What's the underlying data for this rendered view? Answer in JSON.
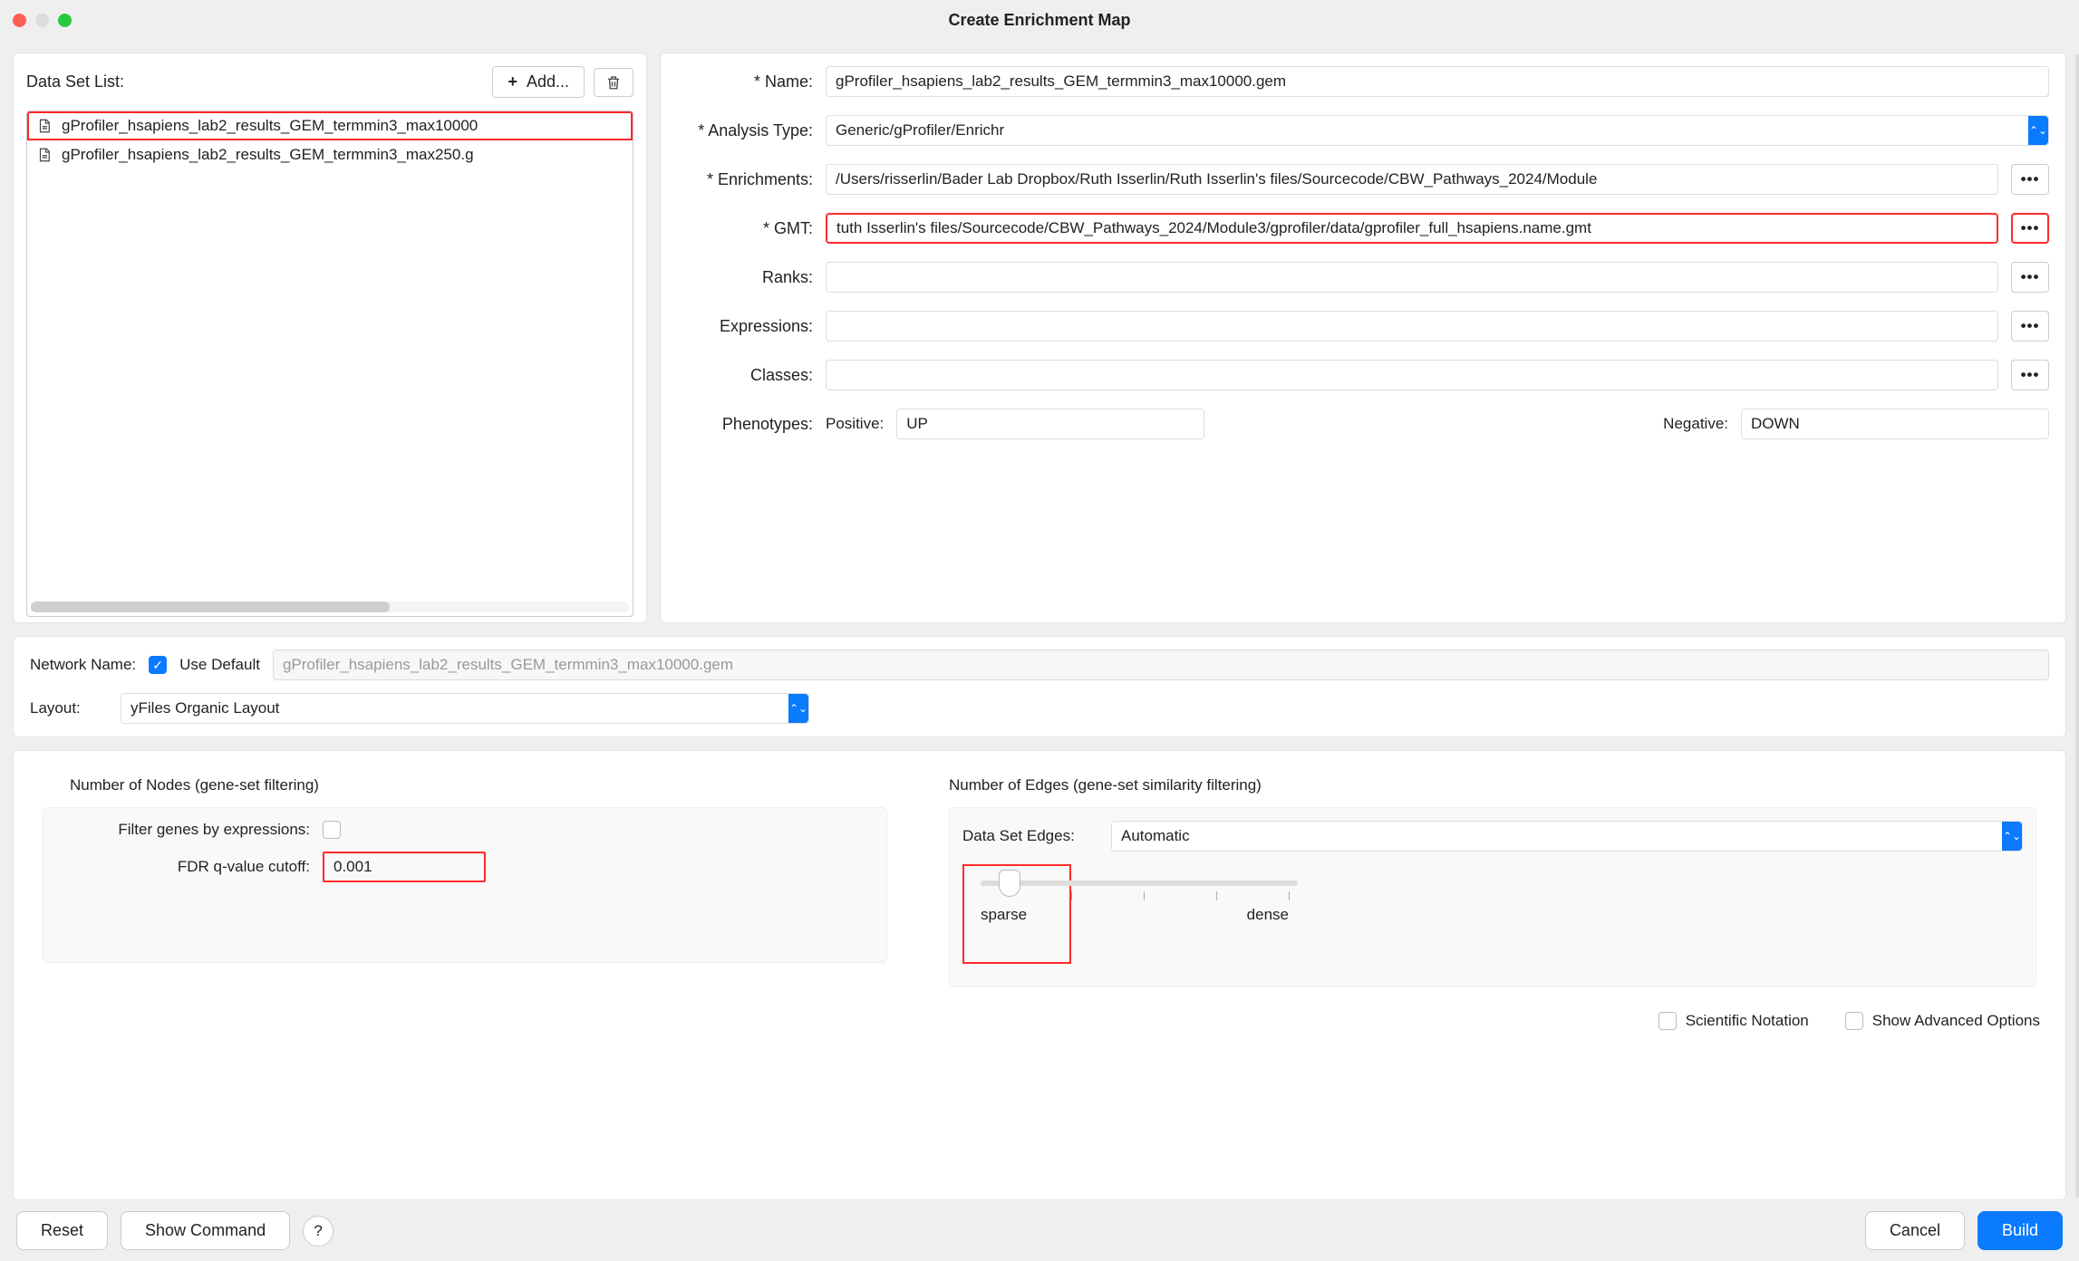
{
  "window": {
    "title": "Create Enrichment Map"
  },
  "dataset_list": {
    "label": "Data Set List:",
    "add_label": "Add...",
    "items": [
      {
        "name": "gProfiler_hsapiens_lab2_results_GEM_termmin3_max10000",
        "selected": true
      },
      {
        "name": "gProfiler_hsapiens_lab2_results_GEM_termmin3_max250.g",
        "selected": false
      }
    ]
  },
  "form": {
    "name": {
      "label": "* Name:",
      "value": "gProfiler_hsapiens_lab2_results_GEM_termmin3_max10000.gem"
    },
    "analysis_type": {
      "label": "* Analysis Type:",
      "value": "Generic/gProfiler/Enrichr"
    },
    "enrichments": {
      "label": "* Enrichments:",
      "value": "/Users/risserlin/Bader Lab Dropbox/Ruth Isserlin/Ruth Isserlin's files/Sourcecode/CBW_Pathways_2024/Module"
    },
    "gmt": {
      "label": "* GMT:",
      "value": "tuth Isserlin's files/Sourcecode/CBW_Pathways_2024/Module3/gprofiler/data/gprofiler_full_hsapiens.name.gmt"
    },
    "ranks": {
      "label": "Ranks:",
      "value": ""
    },
    "expressions": {
      "label": "Expressions:",
      "value": ""
    },
    "classes": {
      "label": "Classes:",
      "value": ""
    },
    "phenotypes": {
      "label": "Phenotypes:",
      "positive_label": "Positive:",
      "positive": "UP",
      "negative_label": "Negative:",
      "negative": "DOWN"
    }
  },
  "network": {
    "name_label": "Network Name:",
    "use_default_label": "Use Default",
    "use_default": true,
    "name_placeholder": "gProfiler_hsapiens_lab2_results_GEM_termmin3_max10000.gem",
    "layout_label": "Layout:",
    "layout_value": "yFiles Organic Layout"
  },
  "nodes_filter": {
    "title": "Number of Nodes (gene-set filtering)",
    "filter_by_expr_label": "Filter genes by expressions:",
    "filter_by_expr": false,
    "fdr_label": "FDR q-value cutoff:",
    "fdr_value": "0.001"
  },
  "edges_filter": {
    "title": "Number of Edges (gene-set similarity filtering)",
    "dse_label": "Data Set Edges:",
    "dse_value": "Automatic",
    "sparse_label": "sparse",
    "dense_label": "dense"
  },
  "options": {
    "scientific_label": "Scientific Notation",
    "advanced_label": "Show Advanced Options"
  },
  "footer": {
    "reset": "Reset",
    "show_command": "Show Command",
    "cancel": "Cancel",
    "build": "Build"
  }
}
